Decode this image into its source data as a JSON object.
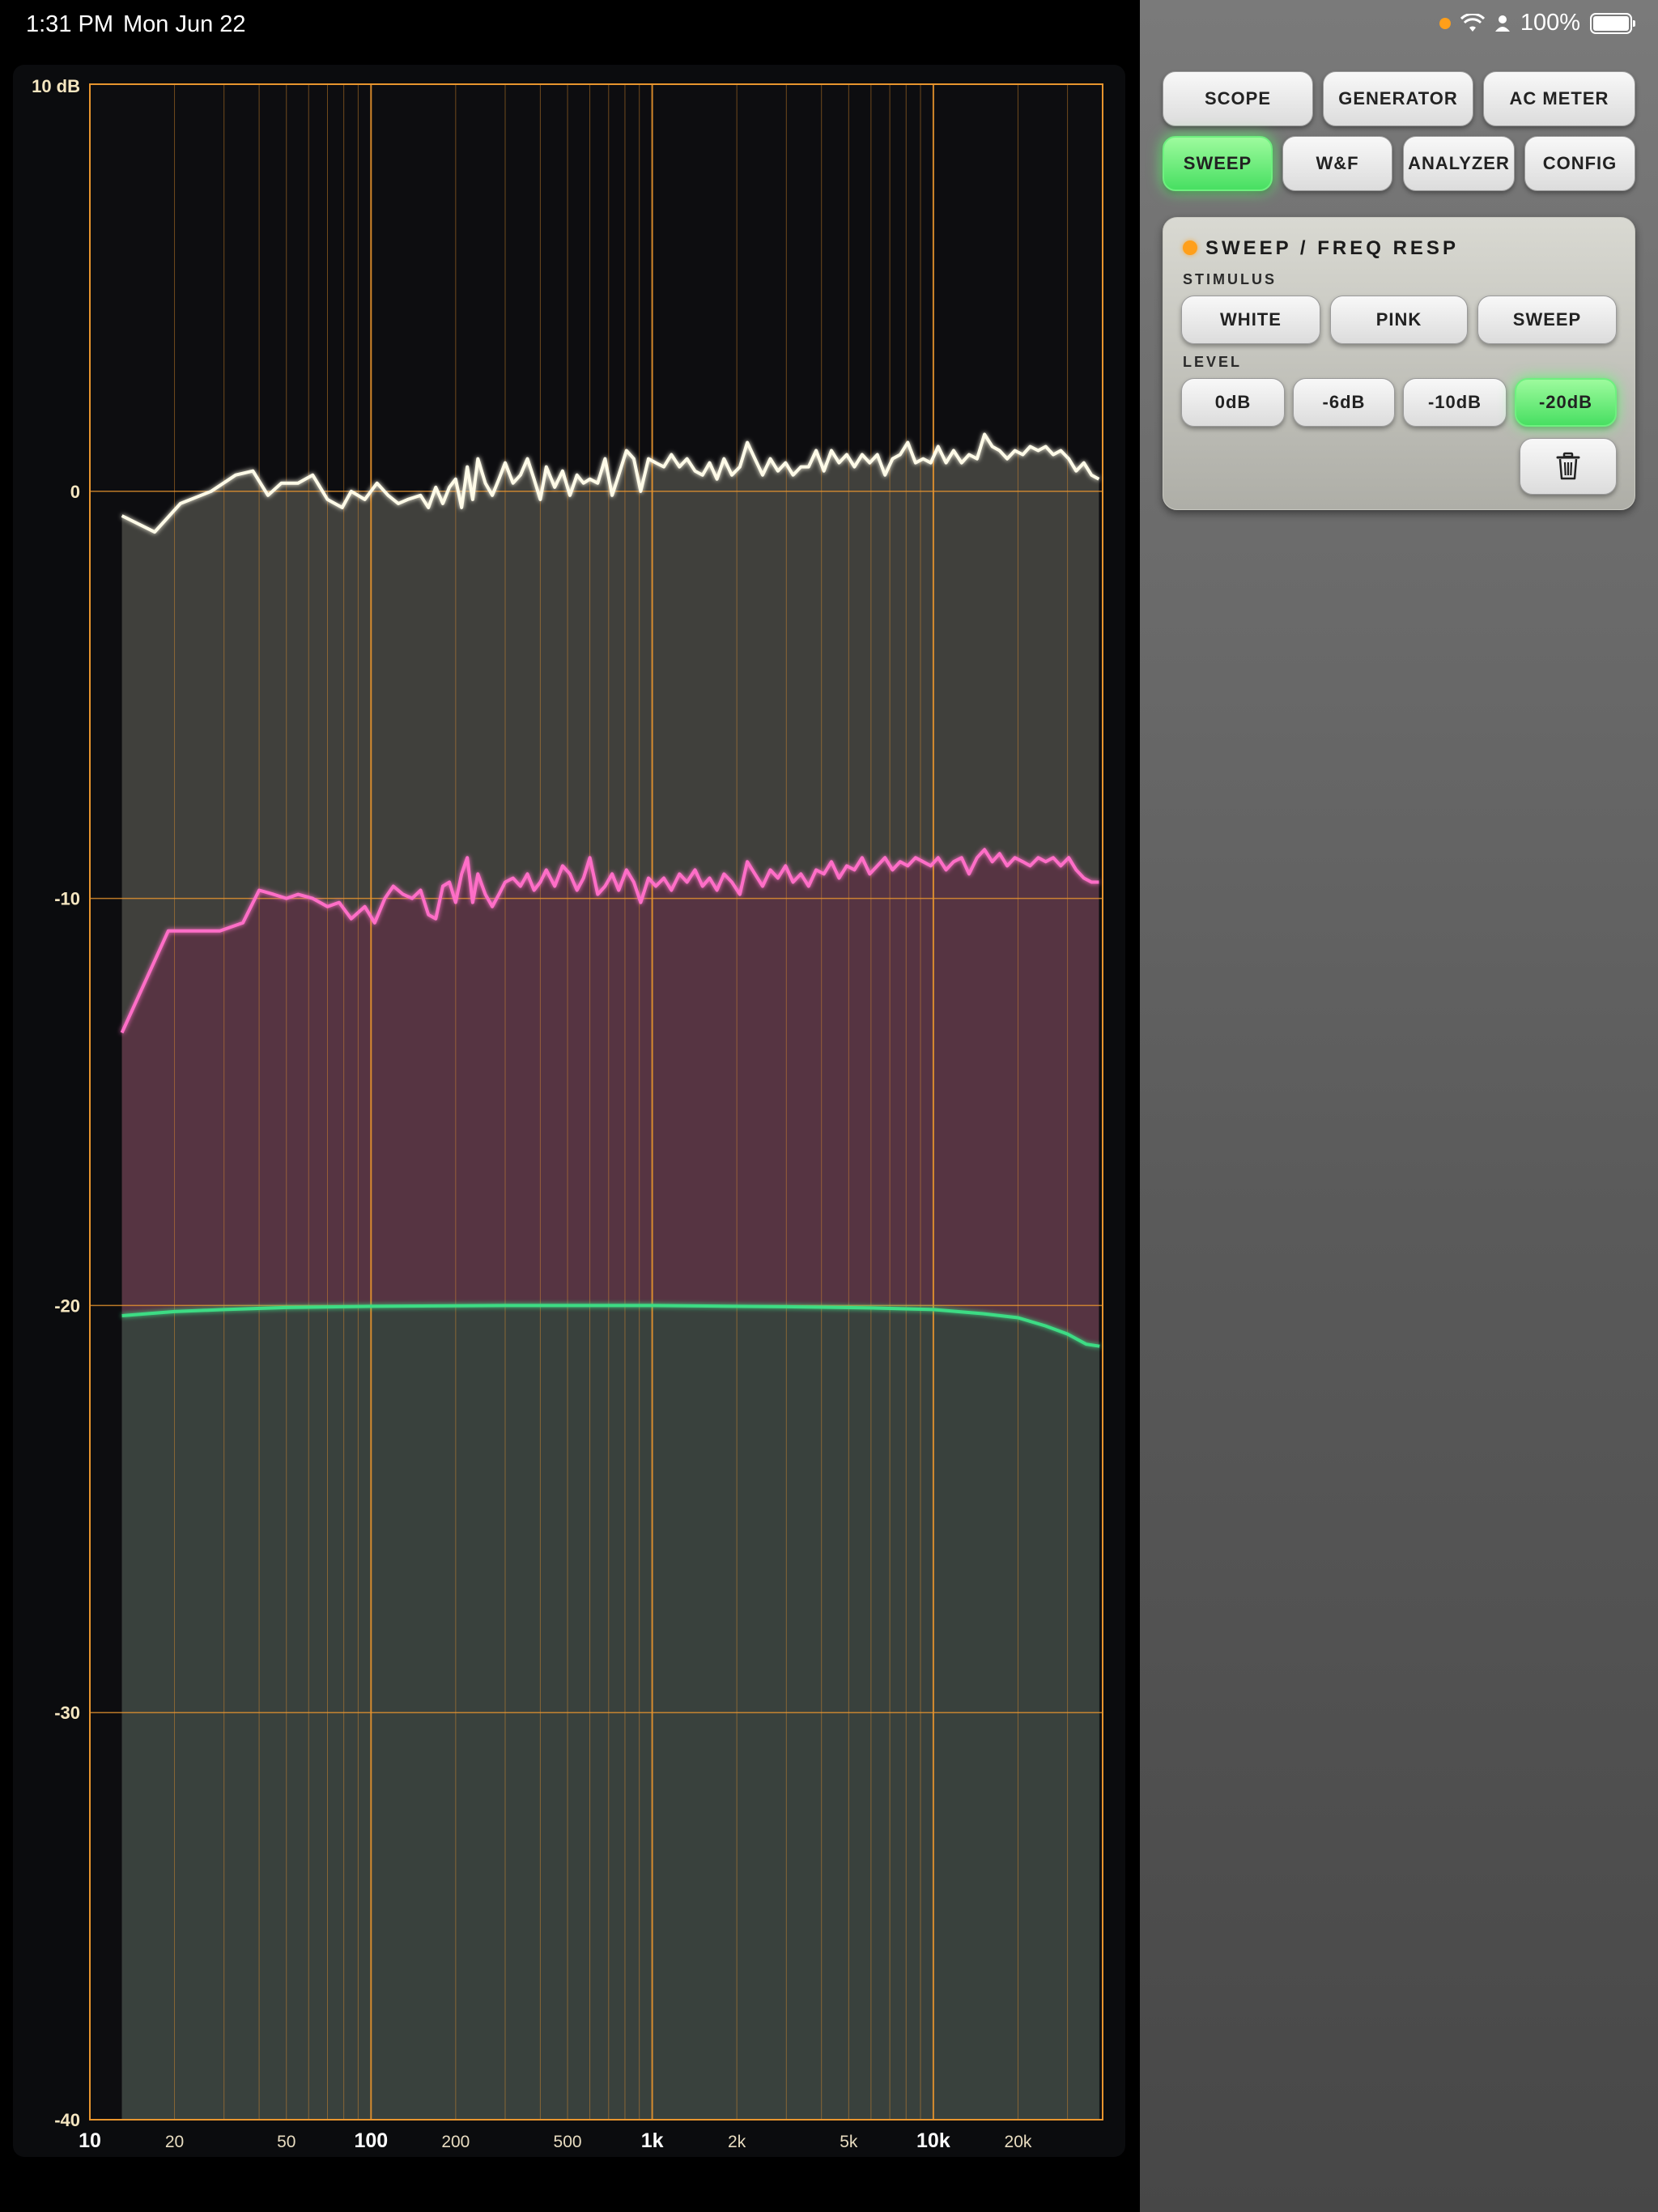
{
  "status_bar": {
    "time": "1:31 PM",
    "date": "Mon Jun 22",
    "battery_text": "100%"
  },
  "tabs": [
    {
      "label": "SCOPE",
      "active": false
    },
    {
      "label": "GENERATOR",
      "active": false
    },
    {
      "label": "AC METER",
      "active": false
    },
    {
      "label": "SWEEP",
      "active": true
    },
    {
      "label": "W&F",
      "active": false
    },
    {
      "label": "ANALYZER",
      "active": false
    },
    {
      "label": "CONFIG",
      "active": false
    }
  ],
  "sweep_panel": {
    "title": "SWEEP / FREQ RESP",
    "stimulus_label": "STIMULUS",
    "stimulus_options": [
      "WHITE",
      "PINK",
      "SWEEP"
    ],
    "level_label": "LEVEL",
    "level_options": [
      "0dB",
      "-6dB",
      "-10dB",
      "-20dB"
    ],
    "level_selected": "-20dB",
    "clear_icon": "trash-icon"
  },
  "colors": {
    "grid": "#e8952e",
    "white_trace": "#fffbe8",
    "pink_trace": "#ff6ec7",
    "green_trace": "#3ddc84",
    "active_button": "#57e86c",
    "indicator": "#ff9f1a"
  },
  "chart_data": {
    "type": "line",
    "xscale": "log",
    "xlim": [
      10,
      40000
    ],
    "ylim": [
      -40,
      10
    ],
    "ylabel_top": "10 dB",
    "y_ticks": [
      {
        "value": 10,
        "label": "10 dB"
      },
      {
        "value": 0,
        "label": "0"
      },
      {
        "value": -10,
        "label": "-10"
      },
      {
        "value": -20,
        "label": "-20"
      },
      {
        "value": -30,
        "label": "-30"
      },
      {
        "value": -40,
        "label": "-40"
      }
    ],
    "x_ticks": [
      {
        "value": 10,
        "label": "10",
        "major": true
      },
      {
        "value": 20,
        "label": "20",
        "major": false
      },
      {
        "value": 50,
        "label": "50",
        "major": false
      },
      {
        "value": 100,
        "label": "100",
        "major": true
      },
      {
        "value": 200,
        "label": "200",
        "major": false
      },
      {
        "value": 500,
        "label": "500",
        "major": false
      },
      {
        "value": 1000,
        "label": "1k",
        "major": true
      },
      {
        "value": 2000,
        "label": "2k",
        "major": false
      },
      {
        "value": 5000,
        "label": "5k",
        "major": false
      },
      {
        "value": 10000,
        "label": "10k",
        "major": true
      },
      {
        "value": 20000,
        "label": "20k",
        "major": false
      }
    ],
    "grid": true,
    "series": [
      {
        "color": "#fffbe8",
        "fill": "#4a4a44",
        "points": [
          [
            13,
            -0.6
          ],
          [
            17,
            -1.0
          ],
          [
            21,
            -0.3
          ],
          [
            27,
            0
          ],
          [
            33,
            0.4
          ],
          [
            38,
            0.5
          ],
          [
            43,
            -0.1
          ],
          [
            48,
            0.2
          ],
          [
            55,
            0.2
          ],
          [
            62,
            0.4
          ],
          [
            70,
            -0.2
          ],
          [
            79,
            -0.4
          ],
          [
            85,
            0
          ],
          [
            95,
            -0.2
          ],
          [
            105,
            0.2
          ],
          [
            115,
            -0.1
          ],
          [
            125,
            -0.3
          ],
          [
            135,
            -0.2
          ],
          [
            150,
            -0.1
          ],
          [
            160,
            -0.4
          ],
          [
            170,
            0.1
          ],
          [
            180,
            -0.3
          ],
          [
            190,
            0.1
          ],
          [
            200,
            0.3
          ],
          [
            210,
            -0.4
          ],
          [
            220,
            0.6
          ],
          [
            230,
            -0.2
          ],
          [
            240,
            0.8
          ],
          [
            255,
            0.2
          ],
          [
            270,
            -0.1
          ],
          [
            285,
            0.3
          ],
          [
            300,
            0.7
          ],
          [
            320,
            0.2
          ],
          [
            340,
            0.4
          ],
          [
            360,
            0.8
          ],
          [
            380,
            0.3
          ],
          [
            400,
            -0.2
          ],
          [
            420,
            0.6
          ],
          [
            450,
            0.1
          ],
          [
            480,
            0.5
          ],
          [
            510,
            -0.1
          ],
          [
            540,
            0.4
          ],
          [
            570,
            0.2
          ],
          [
            600,
            0.3
          ],
          [
            640,
            0.2
          ],
          [
            680,
            0.8
          ],
          [
            720,
            -0.1
          ],
          [
            760,
            0.4
          ],
          [
            810,
            1.0
          ],
          [
            860,
            0.8
          ],
          [
            910,
            0.0
          ],
          [
            970,
            0.8
          ],
          [
            1030,
            0.7
          ],
          [
            1100,
            0.6
          ],
          [
            1170,
            0.9
          ],
          [
            1250,
            0.6
          ],
          [
            1330,
            0.8
          ],
          [
            1420,
            0.5
          ],
          [
            1510,
            0.4
          ],
          [
            1600,
            0.7
          ],
          [
            1700,
            0.3
          ],
          [
            1800,
            0.8
          ],
          [
            1920,
            0.4
          ],
          [
            2050,
            0.6
          ],
          [
            2180,
            1.2
          ],
          [
            2320,
            0.8
          ],
          [
            2470,
            0.4
          ],
          [
            2630,
            0.8
          ],
          [
            2800,
            0.5
          ],
          [
            2980,
            0.7
          ],
          [
            3170,
            0.4
          ],
          [
            3380,
            0.6
          ],
          [
            3600,
            0.6
          ],
          [
            3830,
            1.0
          ],
          [
            4080,
            0.5
          ],
          [
            4340,
            1.0
          ],
          [
            4620,
            0.7
          ],
          [
            4920,
            0.9
          ],
          [
            5240,
            0.6
          ],
          [
            5580,
            0.9
          ],
          [
            5940,
            0.7
          ],
          [
            6320,
            0.9
          ],
          [
            6730,
            0.4
          ],
          [
            7160,
            0.8
          ],
          [
            7620,
            0.9
          ],
          [
            8110,
            1.2
          ],
          [
            8640,
            0.7
          ],
          [
            9200,
            0.8
          ],
          [
            9790,
            0.7
          ],
          [
            10400,
            1.1
          ],
          [
            11100,
            0.7
          ],
          [
            11800,
            1.0
          ],
          [
            12600,
            0.7
          ],
          [
            13400,
            0.9
          ],
          [
            14300,
            0.8
          ],
          [
            15200,
            1.4
          ],
          [
            16200,
            1.1
          ],
          [
            17200,
            1.0
          ],
          [
            18300,
            0.8
          ],
          [
            19500,
            1.0
          ],
          [
            20800,
            0.9
          ],
          [
            22100,
            1.1
          ],
          [
            23600,
            1.0
          ],
          [
            25100,
            1.1
          ],
          [
            26700,
            0.9
          ],
          [
            28400,
            1.0
          ],
          [
            30300,
            0.8
          ],
          [
            32200,
            0.5
          ],
          [
            34300,
            0.7
          ],
          [
            36500,
            0.4
          ],
          [
            38800,
            0.3
          ]
        ]
      },
      {
        "color": "#ff6ec7",
        "fill": "#5a3343",
        "points": [
          [
            13,
            -13.3
          ],
          [
            19,
            -10.8
          ],
          [
            23,
            -10.8
          ],
          [
            29,
            -10.8
          ],
          [
            35,
            -10.6
          ],
          [
            40,
            -9.8
          ],
          [
            45,
            -9.9
          ],
          [
            50,
            -10.0
          ],
          [
            55,
            -9.9
          ],
          [
            62,
            -10.0
          ],
          [
            70,
            -10.2
          ],
          [
            77,
            -10.1
          ],
          [
            85,
            -10.5
          ],
          [
            95,
            -10.2
          ],
          [
            103,
            -10.6
          ],
          [
            112,
            -10.0
          ],
          [
            120,
            -9.7
          ],
          [
            130,
            -9.9
          ],
          [
            140,
            -10.0
          ],
          [
            150,
            -9.8
          ],
          [
            160,
            -10.4
          ],
          [
            170,
            -10.5
          ],
          [
            180,
            -9.7
          ],
          [
            190,
            -9.6
          ],
          [
            200,
            -10.1
          ],
          [
            210,
            -9.4
          ],
          [
            220,
            -9.0
          ],
          [
            230,
            -10.1
          ],
          [
            240,
            -9.4
          ],
          [
            255,
            -9.9
          ],
          [
            270,
            -10.2
          ],
          [
            285,
            -9.9
          ],
          [
            300,
            -9.6
          ],
          [
            320,
            -9.5
          ],
          [
            340,
            -9.7
          ],
          [
            360,
            -9.4
          ],
          [
            380,
            -9.8
          ],
          [
            400,
            -9.6
          ],
          [
            420,
            -9.3
          ],
          [
            450,
            -9.7
          ],
          [
            480,
            -9.2
          ],
          [
            510,
            -9.4
          ],
          [
            540,
            -9.8
          ],
          [
            570,
            -9.5
          ],
          [
            600,
            -9.0
          ],
          [
            640,
            -9.9
          ],
          [
            680,
            -9.7
          ],
          [
            720,
            -9.4
          ],
          [
            760,
            -9.8
          ],
          [
            810,
            -9.3
          ],
          [
            860,
            -9.6
          ],
          [
            910,
            -10.1
          ],
          [
            970,
            -9.5
          ],
          [
            1030,
            -9.7
          ],
          [
            1100,
            -9.5
          ],
          [
            1170,
            -9.8
          ],
          [
            1250,
            -9.4
          ],
          [
            1330,
            -9.6
          ],
          [
            1420,
            -9.3
          ],
          [
            1510,
            -9.7
          ],
          [
            1600,
            -9.5
          ],
          [
            1700,
            -9.8
          ],
          [
            1800,
            -9.4
          ],
          [
            1920,
            -9.6
          ],
          [
            2050,
            -9.9
          ],
          [
            2180,
            -9.1
          ],
          [
            2320,
            -9.4
          ],
          [
            2470,
            -9.7
          ],
          [
            2630,
            -9.3
          ],
          [
            2800,
            -9.5
          ],
          [
            2980,
            -9.2
          ],
          [
            3170,
            -9.6
          ],
          [
            3380,
            -9.4
          ],
          [
            3600,
            -9.7
          ],
          [
            3830,
            -9.3
          ],
          [
            4080,
            -9.4
          ],
          [
            4340,
            -9.1
          ],
          [
            4620,
            -9.5
          ],
          [
            4920,
            -9.2
          ],
          [
            5240,
            -9.3
          ],
          [
            5580,
            -9.0
          ],
          [
            5940,
            -9.4
          ],
          [
            6320,
            -9.2
          ],
          [
            6730,
            -9.0
          ],
          [
            7160,
            -9.3
          ],
          [
            7620,
            -9.1
          ],
          [
            8110,
            -9.2
          ],
          [
            8640,
            -9.0
          ],
          [
            9200,
            -9.1
          ],
          [
            9790,
            -9.2
          ],
          [
            10400,
            -9.0
          ],
          [
            11100,
            -9.3
          ],
          [
            11800,
            -9.1
          ],
          [
            12600,
            -9.0
          ],
          [
            13400,
            -9.4
          ],
          [
            14300,
            -9.0
          ],
          [
            15200,
            -8.8
          ],
          [
            16200,
            -9.1
          ],
          [
            17200,
            -8.9
          ],
          [
            18300,
            -9.2
          ],
          [
            19500,
            -9.0
          ],
          [
            20800,
            -9.1
          ],
          [
            22100,
            -9.2
          ],
          [
            23600,
            -9.0
          ],
          [
            25100,
            -9.1
          ],
          [
            26700,
            -9.0
          ],
          [
            28400,
            -9.2
          ],
          [
            30300,
            -9.0
          ],
          [
            32200,
            -9.3
          ],
          [
            34300,
            -9.5
          ],
          [
            36500,
            -9.6
          ],
          [
            38800,
            -9.6
          ]
        ]
      },
      {
        "color": "#3ddc84",
        "fill": "#34443c",
        "points": [
          [
            13,
            -20.25
          ],
          [
            20,
            -20.15
          ],
          [
            30,
            -20.1
          ],
          [
            50,
            -20.05
          ],
          [
            100,
            -20.02
          ],
          [
            300,
            -20.0
          ],
          [
            1000,
            -20.0
          ],
          [
            3000,
            -20.03
          ],
          [
            6000,
            -20.06
          ],
          [
            10000,
            -20.1
          ],
          [
            15000,
            -20.2
          ],
          [
            20000,
            -20.3
          ],
          [
            25000,
            -20.5
          ],
          [
            30000,
            -20.7
          ],
          [
            35000,
            -20.95
          ],
          [
            39000,
            -21.0
          ]
        ]
      }
    ]
  }
}
